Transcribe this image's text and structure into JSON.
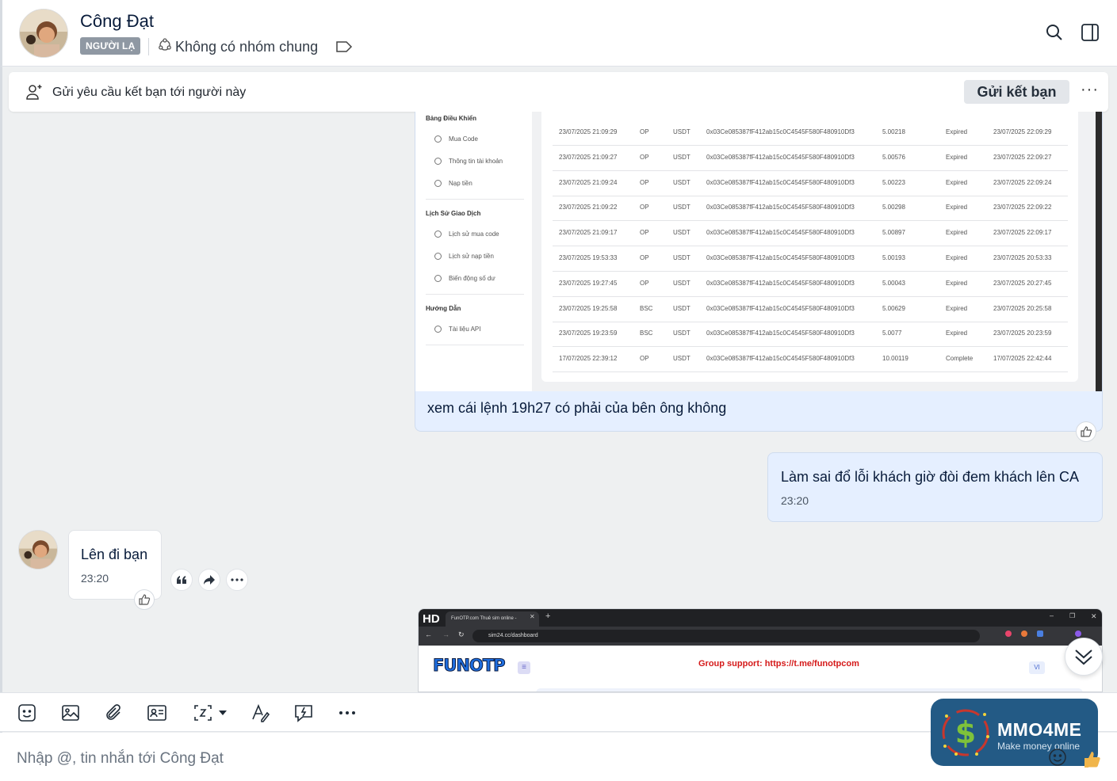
{
  "header": {
    "name": "Công Đạt",
    "badge": "NGƯỜI LẠ",
    "groups": "Không có nhóm chung"
  },
  "friend_request": {
    "text": "Gửi yêu cầu kết bạn tới người này",
    "button": "Gửi kết bạn",
    "more": "···"
  },
  "screenshot1": {
    "sidebar": {
      "sections": [
        {
          "title": "Bảng Điều Khiển",
          "items": [
            "Mua Code",
            "Thông tin tài khoản",
            "Nạp tiền"
          ]
        },
        {
          "title": "Lịch Sử Giao Dịch",
          "items": [
            "Lịch sử mua code",
            "Lịch sử nạp tiền",
            "Biến động số dư"
          ]
        },
        {
          "title": "Hướng Dẫn",
          "items": [
            "Tài liệu API"
          ]
        }
      ]
    },
    "rows": [
      [
        "23/07/2025 21:09:29",
        "OP",
        "USDT",
        "0x03Ce085387fF412ab15c0C4545F580F480910Df3",
        "5.00218",
        "Expired",
        "23/07/2025 22:09:29"
      ],
      [
        "23/07/2025 21:09:27",
        "OP",
        "USDT",
        "0x03Ce085387fF412ab15c0C4545F580F480910Df3",
        "5.00576",
        "Expired",
        "23/07/2025 22:09:27"
      ],
      [
        "23/07/2025 21:09:24",
        "OP",
        "USDT",
        "0x03Ce085387fF412ab15c0C4545F580F480910Df3",
        "5.00223",
        "Expired",
        "23/07/2025 22:09:24"
      ],
      [
        "23/07/2025 21:09:22",
        "OP",
        "USDT",
        "0x03Ce085387fF412ab15c0C4545F580F480910Df3",
        "5.00298",
        "Expired",
        "23/07/2025 22:09:22"
      ],
      [
        "23/07/2025 21:09:17",
        "OP",
        "USDT",
        "0x03Ce085387fF412ab15c0C4545F580F480910Df3",
        "5.00897",
        "Expired",
        "23/07/2025 22:09:17"
      ],
      [
        "23/07/2025 19:53:33",
        "OP",
        "USDT",
        "0x03Ce085387fF412ab15c0C4545F580F480910Df3",
        "5.00193",
        "Expired",
        "23/07/2025 20:53:33"
      ],
      [
        "23/07/2025 19:27:45",
        "OP",
        "USDT",
        "0x03Ce085387fF412ab15c0C4545F580F480910Df3",
        "5.00043",
        "Expired",
        "23/07/2025 20:27:45"
      ],
      [
        "23/07/2025 19:25:58",
        "BSC",
        "USDT",
        "0x03Ce085387fF412ab15c0C4545F580F480910Df3",
        "5.00629",
        "Expired",
        "23/07/2025 20:25:58"
      ],
      [
        "23/07/2025 19:23:59",
        "BSC",
        "USDT",
        "0x03Ce085387fF412ab15c0C4545F580F480910Df3",
        "5.0077",
        "Expired",
        "23/07/2025 20:23:59"
      ],
      [
        "17/07/2025 22:39:12",
        "OP",
        "USDT",
        "0x03Ce085387fF412ab15c0C4545F580F480910Df3",
        "10.00119",
        "Complete",
        "17/07/2025 22:42:44"
      ]
    ]
  },
  "messages": {
    "m1_text": "xem cái lệnh 19h27 có phải của bên ông không",
    "m2_text": "Làm sai đổ lỗi khách giờ đòi đem khách lên CA",
    "m2_time": "23:20",
    "m3_text": "Lên đi bạn",
    "m3_time": "23:20"
  },
  "screenshot2": {
    "hd": "HD",
    "tab_title": "FunOTP.com Thuê sim online -",
    "url": "sim24.cc/dashboard",
    "logo": "FUNOTP",
    "support": "Group support: https://t.me/funotpcom",
    "lang": "VI"
  },
  "input": {
    "placeholder": "Nhập @, tin nhắn tới Công Đạt"
  },
  "watermark": {
    "name": "MMO4ME",
    "tagline": "Make money online"
  },
  "colors": {
    "sent_bubble": "#e5efff",
    "badge": "#8f98a3",
    "accent": "#0068ff"
  }
}
